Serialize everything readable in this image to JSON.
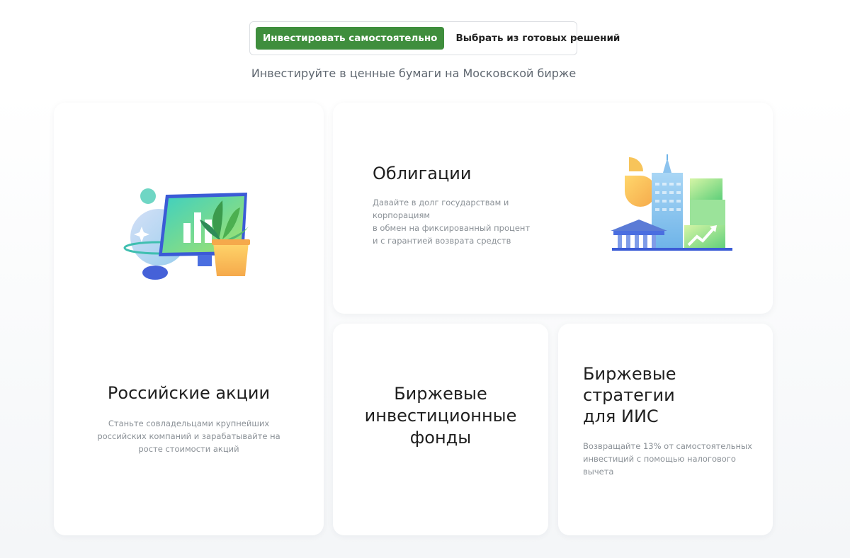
{
  "toggle": {
    "option_self": "Инвестировать самостоятельно",
    "option_ready": "Выбрать из готовых решений"
  },
  "subtitle": "Инвестируйте в ценные бумаги на Московской бирже",
  "cards": {
    "stocks": {
      "title": "Российские акции",
      "description": "Станьте совладельцами крупнейших российских компаний и зарабатывайте на росте стоимости акций"
    },
    "bonds": {
      "title": "Облигации",
      "description_lines": [
        "Давайте в долг государствам и корпорациям",
        "в обмен на фиксированный процент",
        "и с гарантией возврата средств"
      ]
    },
    "etf": {
      "title_lines": [
        "Биржевые",
        "инвестиционные",
        "фонды"
      ]
    },
    "iis": {
      "title_lines": [
        "Биржевые",
        "стратегии",
        "для ИИС"
      ],
      "description": "Возвращайте 13% от самостоятельных инвестиций с помощью налогового вычета"
    }
  },
  "colors": {
    "accent_green": "#3f8e3d",
    "text_dark": "#1f1f1f",
    "text_muted": "#8a9096"
  },
  "icons": {
    "stocks_illustration": "monitor-with-chart-and-plant-illustration",
    "bonds_illustration": "city-buildings-with-chart-illustration"
  }
}
